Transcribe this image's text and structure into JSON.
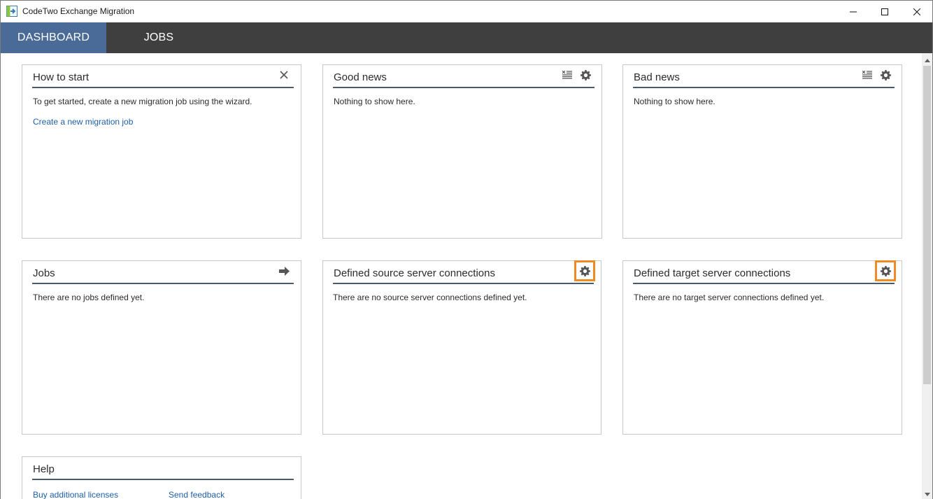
{
  "window": {
    "title": "CodeTwo Exchange Migration",
    "icons": [
      "app-logo-icon",
      "minimize-icon",
      "maximize-icon",
      "close-icon"
    ]
  },
  "nav": {
    "dashboard_label": "DASHBOARD",
    "jobs_label": "JOBS",
    "active": "DASHBOARD"
  },
  "panels": {
    "how_to_start": {
      "title": "How to start",
      "text": "To get started, create a new migration job using the wizard.",
      "link": "Create a new migration job",
      "icon": "close-icon"
    },
    "good_news": {
      "title": "Good news",
      "text": "Nothing to show here.",
      "icons": [
        "clear-list-icon",
        "gear-icon"
      ]
    },
    "bad_news": {
      "title": "Bad news",
      "text": "Nothing to show here.",
      "icons": [
        "clear-list-icon",
        "gear-icon"
      ]
    },
    "jobs": {
      "title": "Jobs",
      "text": "There are no jobs defined yet.",
      "icon": "arrow-right-icon"
    },
    "source_connections": {
      "title": "Defined source server connections",
      "text": "There are no source server connections defined yet.",
      "icon": "gear-icon"
    },
    "target_connections": {
      "title": "Defined target server connections",
      "text": "There are no target server connections defined yet.",
      "icon": "gear-icon"
    },
    "help": {
      "title": "Help",
      "link_licenses": "Buy additional licenses",
      "link_feedback": "Send feedback"
    }
  },
  "colors": {
    "nav_bg": "#3f3f3f",
    "nav_active": "#4a6b98",
    "header_line": "#4a5a6e",
    "link": "#1e5fa8",
    "highlight": "#f08a24"
  }
}
